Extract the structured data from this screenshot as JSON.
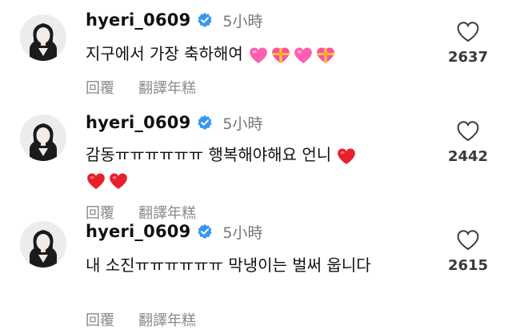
{
  "comments": [
    {
      "username": "hyeri_0609",
      "time": "5小時",
      "text": "지구에서 가장 축하해여",
      "emojis": [
        "pink-heart-emoji",
        "heart-with-ribbon-emoji",
        "pink-heart-emoji",
        "heart-with-ribbon-emoji"
      ],
      "reply_label": "回覆",
      "translate_label": "翻譯年糕",
      "likes": "2637"
    },
    {
      "username": "hyeri_0609",
      "time": "5小時",
      "text": "감동ㅠㅠㅠㅠㅠㅠ 행복해야해요 언니",
      "emojis": [
        "red-heart-emoji",
        "red-heart-emoji",
        "red-heart-emoji"
      ],
      "reply_label": "回覆",
      "translate_label": "翻譯年糕",
      "likes": "2442"
    },
    {
      "username": "hyeri_0609",
      "time": "5小時",
      "text": "내 소진ㅠㅠㅠㅠㅠㅠ 막냉이는 벌써 웁니다",
      "emojis": [],
      "reply_label": "回覆",
      "translate_label": "翻譯年糕",
      "likes": "2615"
    }
  ],
  "colors": {
    "verified": "#3897f0",
    "secondary_text": "#8a8a8a",
    "like_count": "#3a3a3a"
  }
}
